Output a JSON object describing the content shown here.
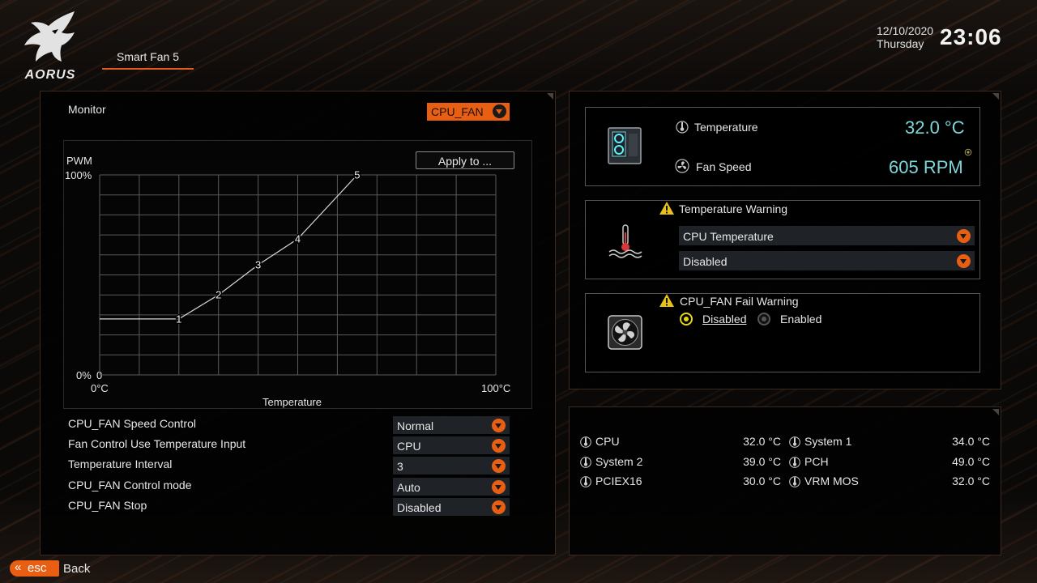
{
  "header": {
    "brand": "AORUS",
    "tab_title": "Smart Fan 5",
    "date": "12/10/2020",
    "weekday": "Thursday",
    "time": "23:06"
  },
  "monitor": {
    "label": "Monitor",
    "fan_select": "CPU_FAN",
    "apply_label": "Apply to ..."
  },
  "chart_data": {
    "type": "line",
    "ylabel": "PWM",
    "xlabel": "Temperature",
    "y_top_label": "100%",
    "y_bottom_label": "0%",
    "origin_label": "0",
    "x_left_label": "0°C",
    "x_right_label": "100°C",
    "xlim": [
      0,
      100
    ],
    "ylim": [
      0,
      100
    ],
    "grid": true,
    "points": [
      {
        "label": "1",
        "x": 20,
        "y": 28
      },
      {
        "label": "2",
        "x": 30,
        "y": 40
      },
      {
        "label": "3",
        "x": 40,
        "y": 55
      },
      {
        "label": "4",
        "x": 50,
        "y": 68
      },
      {
        "label": "5",
        "x": 65,
        "y": 100
      }
    ],
    "start_y": 28
  },
  "settings": [
    {
      "label": "CPU_FAN Speed Control",
      "value": "Normal"
    },
    {
      "label": "Fan Control Use Temperature Input",
      "value": "CPU"
    },
    {
      "label": "Temperature Interval",
      "value": "3"
    },
    {
      "label": "CPU_FAN Control mode",
      "value": "Auto"
    },
    {
      "label": "CPU_FAN Stop",
      "value": "Disabled"
    }
  ],
  "status": {
    "temperature_label": "Temperature",
    "temperature_value": "32.0 °C",
    "fan_speed_label": "Fan Speed",
    "fan_speed_value": "605 RPM"
  },
  "temp_warning": {
    "title": "Temperature Warning",
    "source": "CPU Temperature",
    "state": "Disabled"
  },
  "fail_warning": {
    "title": "CPU_FAN Fail Warning",
    "option_disabled": "Disabled",
    "option_enabled": "Enabled",
    "selected": "Disabled"
  },
  "sensors": [
    {
      "name": "CPU",
      "value": "32.0 °C"
    },
    {
      "name": "System 1",
      "value": "34.0 °C"
    },
    {
      "name": "System 2",
      "value": "39.0 °C"
    },
    {
      "name": "PCH",
      "value": "49.0 °C"
    },
    {
      "name": "PCIEX16",
      "value": "30.0 °C"
    },
    {
      "name": "VRM MOS",
      "value": "32.0 °C"
    }
  ],
  "footer": {
    "esc_label": "esc",
    "back_label": "Back"
  },
  "colors": {
    "accent": "#e85f14",
    "value_cyan": "#7fd6d8",
    "radio_on": "#e6d61a"
  }
}
